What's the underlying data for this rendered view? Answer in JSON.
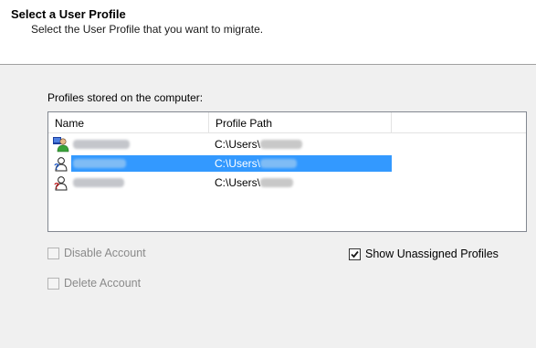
{
  "header": {
    "title": "Select a User Profile",
    "subtitle": "Select the User Profile that you want to migrate."
  },
  "profiles": {
    "label": "Profiles stored on the computer:",
    "columns": {
      "name": "Name",
      "path": "Profile Path"
    },
    "rows": [
      {
        "path_prefix": "C:\\Users\\",
        "icon": "user-green-icon",
        "selected": false
      },
      {
        "path_prefix": "C:\\Users\\",
        "icon": "user-question-icon",
        "selected": true
      },
      {
        "path_prefix": "C:\\Users\\",
        "icon": "user-question-icon",
        "selected": false
      }
    ]
  },
  "options": {
    "disable_account": {
      "label": "Disable Account",
      "checked": false,
      "enabled": false
    },
    "delete_account": {
      "label": "Delete Account",
      "checked": false,
      "enabled": false
    },
    "show_unassigned": {
      "label": "Show Unassigned Profiles",
      "checked": true,
      "enabled": true
    }
  },
  "colors": {
    "selection": "#3399ff",
    "header_bg": "#ffffff",
    "body_bg": "#f0f0f0"
  }
}
